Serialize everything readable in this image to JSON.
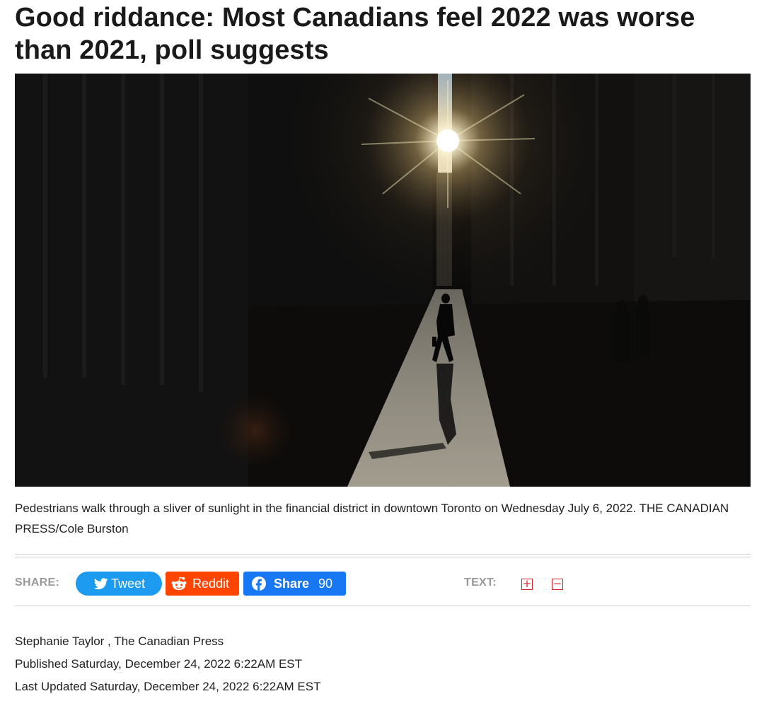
{
  "article": {
    "headline": "Good riddance: Most Canadians feel 2022 was worse than 2021, poll suggests",
    "caption": "Pedestrians walk through a sliver of sunlight in the financial district in downtown Toronto on Wednesday July 6, 2022. THE CANADIAN PRESS/Cole Burston"
  },
  "share": {
    "label": "SHARE:",
    "tweet_label": "Tweet",
    "reddit_label": "Reddit",
    "facebook_label": "Share",
    "facebook_count": "90",
    "text_label": "TEXT:",
    "increase_symbol": "+",
    "decrease_symbol": "−"
  },
  "byline": {
    "author": "Stephanie Taylor , The Canadian Press",
    "published": "Published Saturday, December 24, 2022 6:22AM EST",
    "updated": "Last Updated Saturday, December 24, 2022 6:22AM EST"
  },
  "colors": {
    "tweet": "#1d9bf0",
    "reddit": "#ff4500",
    "facebook": "#1877f2",
    "text_size_accent": "#d9232d",
    "label_gray": "#9a9a9a"
  },
  "icons": {
    "tweet": "twitter-bird-icon",
    "reddit": "reddit-alien-icon",
    "facebook": "facebook-icon",
    "increase": "plus-box-icon",
    "decrease": "minus-box-icon"
  }
}
